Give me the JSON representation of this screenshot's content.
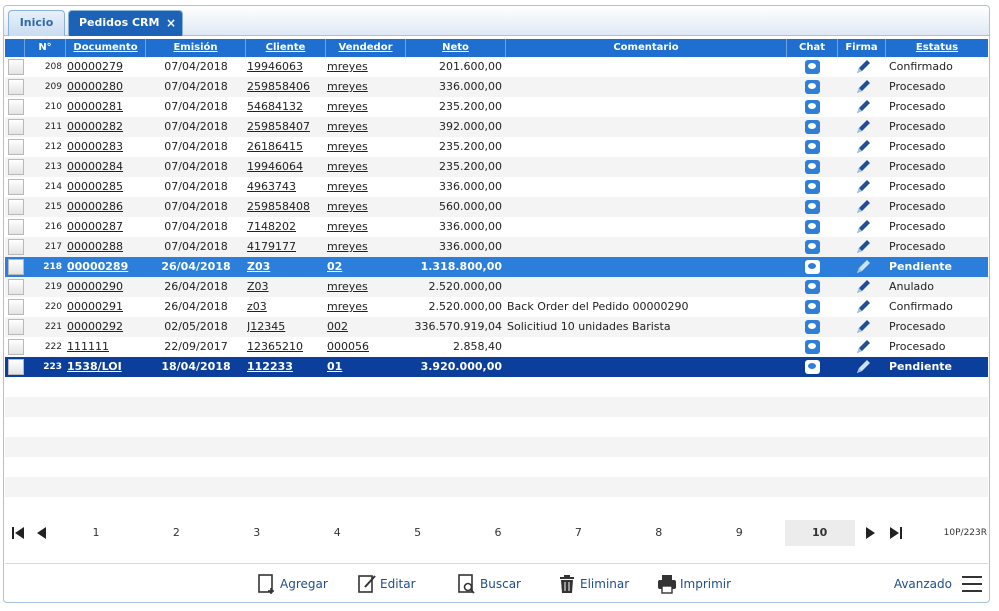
{
  "tabs": [
    {
      "label": "Inicio"
    },
    {
      "label": "Pedidos CRM",
      "close": "×"
    }
  ],
  "columns": {
    "num": "N°",
    "documento": "Documento",
    "emision": "Emisión",
    "cliente": "Cliente",
    "vendedor": "Vendedor",
    "neto": "Neto",
    "comentario": "Comentario",
    "chat": "Chat",
    "firma": "Firma",
    "estatus": "Estatus"
  },
  "rows": [
    {
      "n": "208",
      "doc": "00000279",
      "fecha": "07/04/2018",
      "cliente": "19946063",
      "vendedor": "mreyes",
      "neto": "201.600,00",
      "comentario": "",
      "estatus": "Confirmado",
      "state": "normal"
    },
    {
      "n": "209",
      "doc": "00000280",
      "fecha": "07/04/2018",
      "cliente": "259858406",
      "vendedor": "mreyes",
      "neto": "336.000,00",
      "comentario": "",
      "estatus": "Procesado",
      "state": "normal"
    },
    {
      "n": "210",
      "doc": "00000281",
      "fecha": "07/04/2018",
      "cliente": "54684132",
      "vendedor": "mreyes",
      "neto": "235.200,00",
      "comentario": "",
      "estatus": "Procesado",
      "state": "normal"
    },
    {
      "n": "211",
      "doc": "00000282",
      "fecha": "07/04/2018",
      "cliente": "259858407",
      "vendedor": "mreyes",
      "neto": "392.000,00",
      "comentario": "",
      "estatus": "Procesado",
      "state": "normal"
    },
    {
      "n": "212",
      "doc": "00000283",
      "fecha": "07/04/2018",
      "cliente": "26186415",
      "vendedor": "mreyes",
      "neto": "235.200,00",
      "comentario": "",
      "estatus": "Procesado",
      "state": "normal"
    },
    {
      "n": "213",
      "doc": "00000284",
      "fecha": "07/04/2018",
      "cliente": "19946064",
      "vendedor": "mreyes",
      "neto": "235.200,00",
      "comentario": "",
      "estatus": "Procesado",
      "state": "normal"
    },
    {
      "n": "214",
      "doc": "00000285",
      "fecha": "07/04/2018",
      "cliente": "4963743",
      "vendedor": "mreyes",
      "neto": "336.000,00",
      "comentario": "",
      "estatus": "Procesado",
      "state": "normal"
    },
    {
      "n": "215",
      "doc": "00000286",
      "fecha": "07/04/2018",
      "cliente": "259858408",
      "vendedor": "mreyes",
      "neto": "560.000,00",
      "comentario": "",
      "estatus": "Procesado",
      "state": "normal"
    },
    {
      "n": "216",
      "doc": "00000287",
      "fecha": "07/04/2018",
      "cliente": "7148202",
      "vendedor": "mreyes",
      "neto": "336.000,00",
      "comentario": "",
      "estatus": "Procesado",
      "state": "normal"
    },
    {
      "n": "217",
      "doc": "00000288",
      "fecha": "07/04/2018",
      "cliente": "4179177",
      "vendedor": "mreyes",
      "neto": "336.000,00",
      "comentario": "",
      "estatus": "Procesado",
      "state": "normal"
    },
    {
      "n": "218",
      "doc": "00000289",
      "fecha": "26/04/2018",
      "cliente": "Z03",
      "vendedor": "02",
      "neto": "1.318.800,00",
      "comentario": "",
      "estatus": "Pendiente",
      "state": "hover"
    },
    {
      "n": "219",
      "doc": "00000290",
      "fecha": "26/04/2018",
      "cliente": "Z03",
      "vendedor": "mreyes",
      "neto": "2.520.000,00",
      "comentario": "",
      "estatus": "Anulado",
      "state": "normal"
    },
    {
      "n": "220",
      "doc": "00000291",
      "fecha": "26/04/2018",
      "cliente": "z03",
      "vendedor": "mreyes",
      "neto": "2.520.000,00",
      "comentario": "Back Order del Pedido 00000290",
      "estatus": "Confirmado",
      "state": "normal"
    },
    {
      "n": "221",
      "doc": "00000292",
      "fecha": "02/05/2018",
      "cliente": "J12345",
      "vendedor": "002",
      "neto": "336.570.919,04",
      "comentario": "Solicitiud 10 unidades Barista",
      "estatus": "Procesado",
      "state": "normal"
    },
    {
      "n": "222",
      "doc": "111111",
      "fecha": "22/09/2017",
      "cliente": "12365210",
      "vendedor": "000056",
      "neto": "2.858,40",
      "comentario": "",
      "estatus": "Procesado",
      "state": "normal"
    },
    {
      "n": "223",
      "doc": "1538/LOI",
      "fecha": "18/04/2018",
      "cliente": "112233",
      "vendedor": "01",
      "neto": "3.920.000,00",
      "comentario": "",
      "estatus": "Pendiente",
      "state": "selected"
    }
  ],
  "pager": {
    "pages": [
      "1",
      "2",
      "3",
      "4",
      "5",
      "6",
      "7",
      "8",
      "9",
      "10"
    ],
    "active_page": "10",
    "info": "10P/223R",
    "icons": [
      "first-page-icon",
      "prev-page-icon",
      "next-page-icon",
      "last-page-icon"
    ]
  },
  "toolbar": {
    "agregar": "Agregar",
    "editar": "Editar",
    "buscar": "Buscar",
    "eliminar": "Eliminar",
    "imprimir": "Imprimir",
    "avanzado": "Avanzado"
  },
  "colors": {
    "header": "#1e6fcf",
    "hover_row": "#2b7fdb",
    "selected_row": "#0b3f9b",
    "tab_active": "#1c63b7",
    "link_text": "#1e4e8c"
  }
}
